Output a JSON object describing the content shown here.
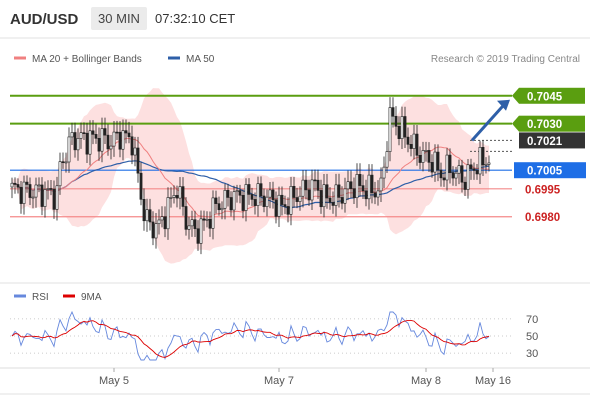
{
  "header": {
    "pair": "AUD/USD",
    "timeframe": "30 MIN",
    "time": "07:32:10 CET"
  },
  "legend": {
    "ma20_label": "MA 20 + Bollinger Bands",
    "ma50_label": "MA 50",
    "credit": "Research © 2019 Trading Central",
    "rsi_label": "RSI",
    "ma9_label": "9MA"
  },
  "colors": {
    "ma20": "#f08080",
    "bollinger_fill": "#fcd6d6",
    "ma50": "#2e5fa8",
    "target_line": "#5a9e10",
    "target_label_bg": "#5a9e10",
    "current_label_bg": "#333333",
    "ma50_label_bg": "#1e6ee6",
    "support_line": "#f48a8a",
    "support_text": "#cc2222",
    "forecast_arrow": "#2e5fa8",
    "candle": "#222222",
    "rsi": "#6688dd",
    "ma9": "#dd0000"
  },
  "chart_data": [
    {
      "type": "candlestick",
      "title": "AUD/USD",
      "x_axis_labels": [
        "May 5",
        "May 7",
        "May 8",
        "May 16"
      ],
      "series": [
        {
          "name": "MA 20 + Bollinger Bands"
        },
        {
          "name": "MA 50"
        }
      ],
      "levels": [
        {
          "value": "0.7045",
          "type": "target"
        },
        {
          "value": "0.7030",
          "type": "target"
        },
        {
          "value": "0.7021",
          "type": "current"
        },
        {
          "value": "0.7005",
          "type": "ma50"
        },
        {
          "value": "0.6995",
          "type": "support"
        },
        {
          "value": "0.6980",
          "type": "support"
        }
      ],
      "forecast": {
        "direction": "up",
        "from": 0.7021,
        "to": 0.7045
      },
      "ylim": [
        0.6946,
        0.7061
      ]
    },
    {
      "type": "line",
      "title": "",
      "series": [
        {
          "name": "RSI"
        },
        {
          "name": "9MA"
        }
      ],
      "y_ticks": [
        "70",
        "50",
        "30"
      ],
      "ylim": [
        15,
        85
      ]
    }
  ]
}
